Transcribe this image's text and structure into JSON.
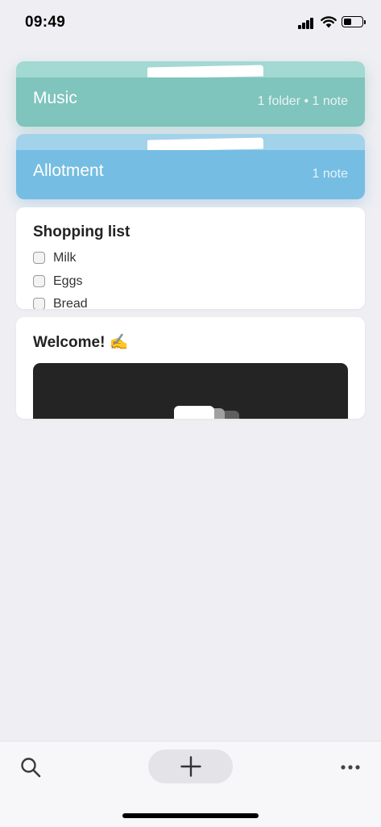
{
  "status_bar": {
    "time": "09:49"
  },
  "folders": [
    {
      "name": "Music",
      "meta": "1 folder • 1 note",
      "color": "#7fc4bd"
    },
    {
      "name": "Allotment",
      "meta": "1 note",
      "color": "#75bde2"
    }
  ],
  "notes": {
    "shopping": {
      "title": "Shopping list",
      "items": [
        {
          "label": "Milk",
          "checked": false
        },
        {
          "label": "Eggs",
          "checked": false
        },
        {
          "label": "Bread",
          "checked": false
        }
      ]
    },
    "welcome": {
      "title": "Welcome! ✍️"
    }
  },
  "toolbar": {
    "search_icon": "search-icon",
    "add_icon": "plus-icon",
    "more_icon": "more-icon"
  }
}
